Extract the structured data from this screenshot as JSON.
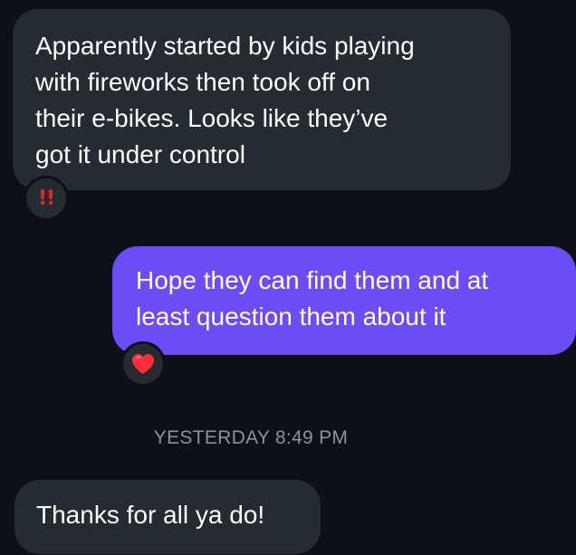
{
  "messages": [
    {
      "direction": "incoming",
      "lines": [
        "Apparently started by kids playing",
        "with fireworks then took off on",
        "their e-bikes. Looks like they’ve",
        "got it under control"
      ],
      "reaction": "!!",
      "reaction_icon": "double-exclamation-icon"
    },
    {
      "direction": "outgoing",
      "lines": [
        "Hope they can find them and at",
        "least question them about it"
      ],
      "reaction_icon": "heart-icon"
    },
    {
      "direction": "incoming",
      "lines": [
        "Thanks for all ya do!"
      ]
    }
  ],
  "timestamp": "YESTERDAY 8:49 PM",
  "colors": {
    "background": "#0d1117",
    "incoming_bubble": "#262a31",
    "outgoing_bubble": "#6b4cf5",
    "timestamp_text": "#8d929b",
    "exclaim": "#e5281f",
    "heart": "#ff2d3a"
  }
}
